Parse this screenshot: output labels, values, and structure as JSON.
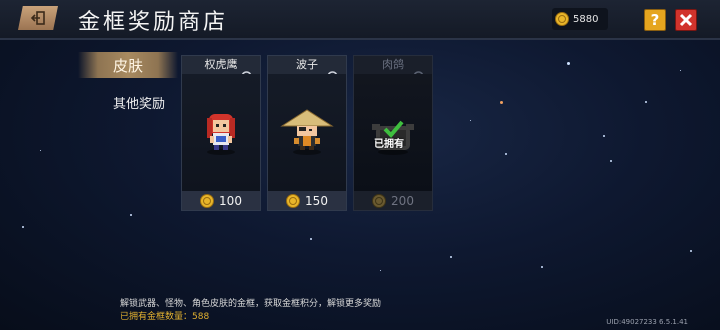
{
  "header": {
    "title": "金框奖励商店",
    "coins": "5880"
  },
  "tabs": [
    {
      "label": "皮肤",
      "active": true
    },
    {
      "label": "其他奖励",
      "active": false
    }
  ],
  "items": [
    {
      "name": "权虎鹰",
      "price": "100",
      "owned": false
    },
    {
      "name": "波子",
      "price": "150",
      "owned": false
    },
    {
      "name": "肉鸽",
      "price": "200",
      "owned": true,
      "owned_label": "已拥有"
    }
  ],
  "footer": {
    "hint": "解锁武器、怪物、角色皮肤的金框，获取金框积分，解锁更多奖励",
    "owned_count": "已拥有金框数量：588"
  },
  "uid": "UID:49027233 6.5.1.41",
  "colors": {
    "coin": "#e8b52a",
    "help": "#e5a51f",
    "close": "#d1332c",
    "active_tab": "#a88a60"
  }
}
